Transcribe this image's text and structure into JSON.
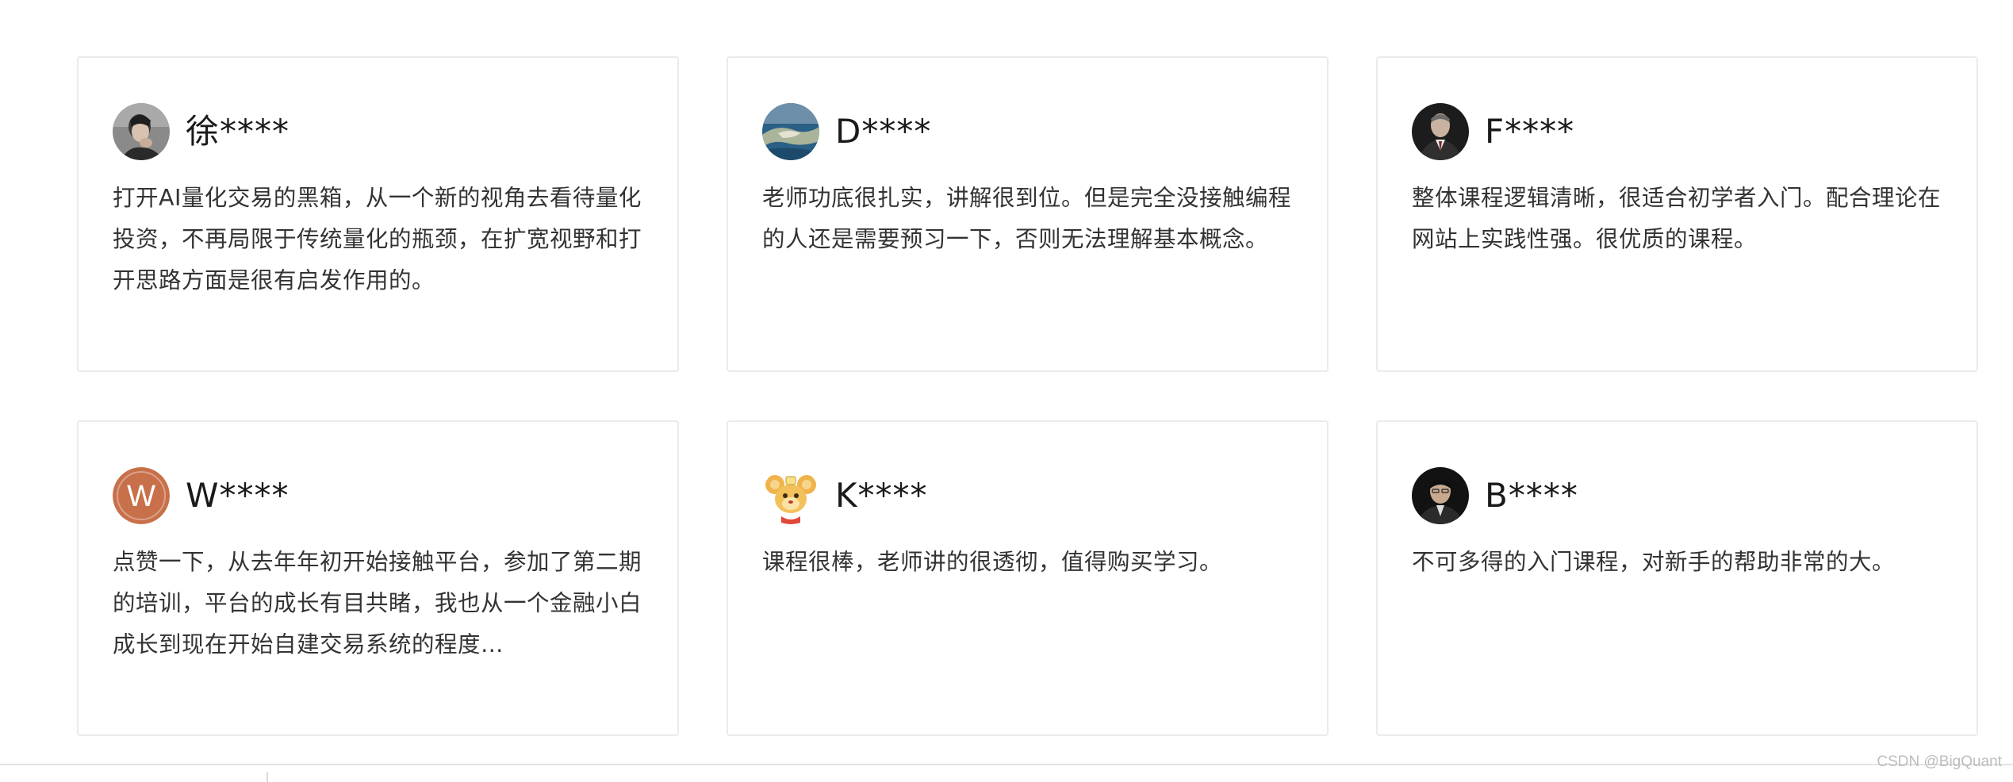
{
  "reviews": [
    {
      "username": "徐****",
      "avatar_icon": "man-photo-avatar-icon",
      "text": "打开AI量化交易的黑箱，从一个新的视角去看待量化投资，不再局限于传统量化的瓶颈，在扩宽视野和打开思路方面是很有启发作用的。"
    },
    {
      "username": "D****",
      "avatar_icon": "coastline-photo-avatar-icon",
      "text": "老师功底很扎实，讲解很到位。但是完全没接触编程的人还是需要预习一下，否则无法理解基本概念。"
    },
    {
      "username": "F****",
      "avatar_icon": "suit-man-photo-avatar-icon",
      "text": "整体课程逻辑清晰，很适合初学者入门。配合理论在网站上实践性强。很优质的课程。"
    },
    {
      "username": "W****",
      "avatar_icon": "letter-w-avatar-icon",
      "avatar_letter": "W",
      "avatar_color": "#c8704a",
      "text": "点赞一下，从去年年初开始接触平台，参加了第二期的培训，平台的成长有目共睹，我也从一个金融小白成长到现在开始自建交易系统的程度…"
    },
    {
      "username": "K****",
      "avatar_icon": "cartoon-mouse-avatar-icon",
      "text": "课程很棒，老师讲的很透彻，值得购买学习。"
    },
    {
      "username": "B****",
      "avatar_icon": "man-portrait-photo-avatar-icon",
      "text": "不可多得的入门课程，对新手的帮助非常的大。"
    }
  ],
  "watermark": "CSDN @BigQuant"
}
